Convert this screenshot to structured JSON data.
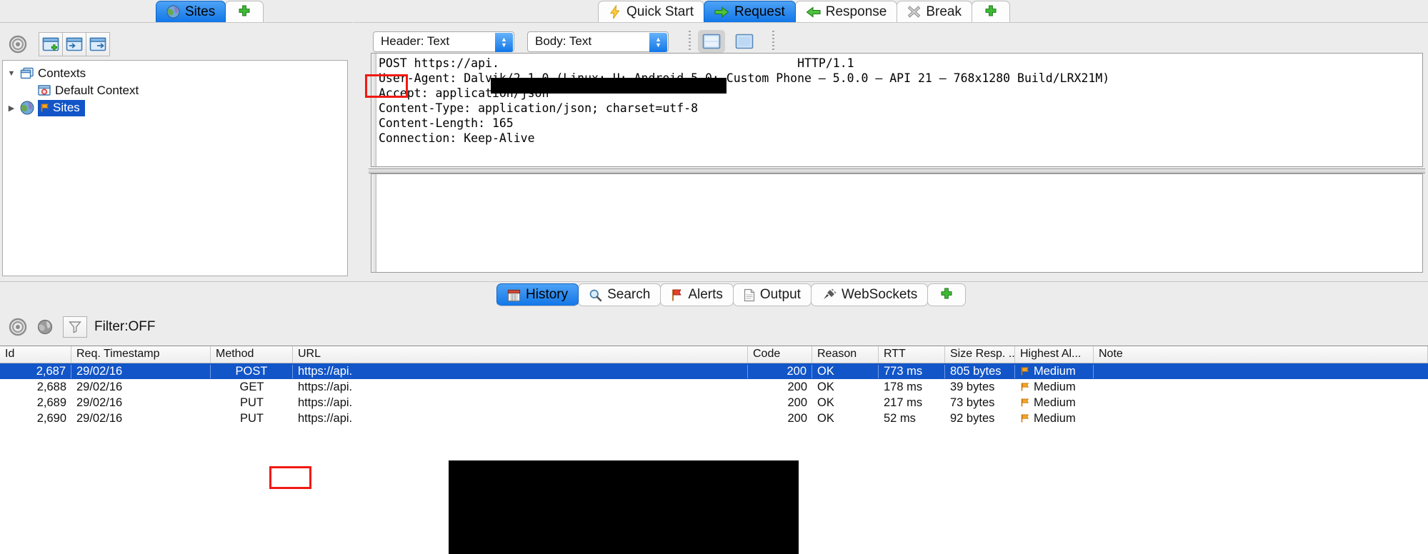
{
  "sites_panel": {
    "tabs": [
      {
        "label": "Sites",
        "icon": "globe-icon",
        "selected": true
      },
      {
        "label": "+",
        "icon": "plus-icon",
        "selected": false
      }
    ],
    "toolbar": [
      {
        "name": "options-target-icon"
      },
      {
        "name": "new-context-icon"
      },
      {
        "name": "import-context-icon"
      },
      {
        "name": "export-context-icon"
      }
    ],
    "tree": [
      {
        "label": "Contexts",
        "icon": "contexts-icon",
        "twisty": "▼",
        "indent": 0,
        "selected": false
      },
      {
        "label": "Default Context",
        "icon": "default-context-icon",
        "twisty": "",
        "indent": 1,
        "selected": false
      },
      {
        "label": "Sites",
        "icon": "globe-icon",
        "twisty": "▶",
        "indent": 0,
        "selected": true
      }
    ]
  },
  "request_panel": {
    "tabs": [
      {
        "label": "Quick Start",
        "icon": "lightning-icon",
        "selected": false
      },
      {
        "label": "Request",
        "icon": "arrow-right-icon",
        "selected": true
      },
      {
        "label": "Response",
        "icon": "arrow-left-icon",
        "selected": false
      },
      {
        "label": "Break",
        "icon": "x-mark-icon",
        "selected": false
      },
      {
        "label": "+",
        "icon": "plus-icon",
        "selected": false
      }
    ],
    "header_select": {
      "value": "Header: Text",
      "name": "header-view-select"
    },
    "body_select": {
      "value": "Body: Text",
      "name": "body-view-select"
    },
    "view_buttons": [
      {
        "name": "split-view-button",
        "active": true
      },
      {
        "name": "single-view-button",
        "active": false
      }
    ],
    "header_lines": [
      {
        "method": "POST",
        "url_prefix": "https://api.",
        "redacted": true,
        "suffix": "HTTP/1.1"
      },
      {
        "text": "User-Agent: Dalvik/2.1.0 (Linux; U; Android 5.0; Custom Phone – 5.0.0 – API 21 – 768x1280 Build/LRX21M)"
      },
      {
        "text": "Accept: application/json"
      },
      {
        "text": "Content-Type: application/json; charset=utf-8"
      },
      {
        "text": "Content-Length: 165"
      },
      {
        "text": "Connection: Keep-Alive"
      }
    ],
    "body_text": ""
  },
  "bottom_panel": {
    "tabs": [
      {
        "label": "History",
        "icon": "calendar-icon",
        "selected": true
      },
      {
        "label": "Search",
        "icon": "magnifier-icon",
        "selected": false
      },
      {
        "label": "Alerts",
        "icon": "flag-red-icon",
        "selected": false
      },
      {
        "label": "Output",
        "icon": "document-icon",
        "selected": false
      },
      {
        "label": "WebSockets",
        "icon": "plug-icon",
        "selected": false
      },
      {
        "label": "+",
        "icon": "plus-icon",
        "selected": false
      }
    ],
    "toolbar": {
      "options_icon": "options-target-icon",
      "globe_icon": "globe-small-icon",
      "filter_icon": "funnel-icon",
      "filter_label": "Filter:OFF"
    },
    "table": {
      "columns": [
        "Id",
        "Req. Timestamp",
        "Method",
        "URL",
        "Code",
        "Reason",
        "RTT",
        "Size Resp. ...",
        "Highest Al...",
        "Note"
      ],
      "rows": [
        {
          "id": "2,687",
          "timestamp": "29/02/16",
          "method": "POST",
          "url": "https://api.",
          "code": "200",
          "reason": "OK",
          "rtt": "773 ms",
          "size": "805 bytes",
          "alert": "Medium",
          "note": "",
          "selected": true
        },
        {
          "id": "2,688",
          "timestamp": "29/02/16",
          "method": "GET",
          "url": "https://api.",
          "code": "200",
          "reason": "OK",
          "rtt": "178 ms",
          "size": "39 bytes",
          "alert": "Medium",
          "note": "",
          "selected": false
        },
        {
          "id": "2,689",
          "timestamp": "29/02/16",
          "method": "PUT",
          "url": "https://api.",
          "code": "200",
          "reason": "OK",
          "rtt": "217 ms",
          "size": "73 bytes",
          "alert": "Medium",
          "note": "",
          "selected": false
        },
        {
          "id": "2,690",
          "timestamp": "29/02/16",
          "method": "PUT",
          "url": "https://api.",
          "code": "200",
          "reason": "OK",
          "rtt": "52 ms",
          "size": "92 bytes",
          "alert": "Medium",
          "note": "",
          "selected": false
        }
      ]
    }
  },
  "annotations": {
    "highlight_color": "#f01a12",
    "boxes": [
      {
        "name": "request-method-highlight",
        "target": "POST"
      },
      {
        "name": "table-method-highlight",
        "target": "POST"
      }
    ]
  },
  "colors": {
    "selection_blue": "#1255c8",
    "tab_blue": "#1277e8",
    "panel_grey": "#ececec",
    "redaction": "#000000",
    "alert_medium": "#f5a623"
  }
}
